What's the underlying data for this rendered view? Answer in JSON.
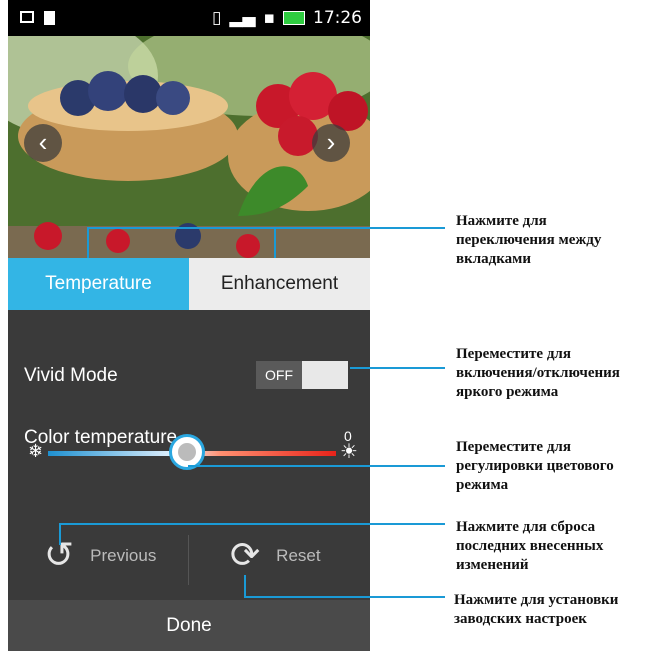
{
  "status_bar": {
    "time": "17:26",
    "icons": [
      "screen-icon",
      "file-icon",
      "vibrate-icon",
      "signal-icon",
      "sd-card-icon",
      "battery-icon"
    ]
  },
  "photo": {
    "prev_glyph": "‹",
    "next_glyph": "›"
  },
  "tabs": [
    {
      "label": "Temperature",
      "active": true
    },
    {
      "label": "Enhancement",
      "active": false
    }
  ],
  "vivid_mode": {
    "label": "Vivid Mode",
    "toggle_state": "OFF"
  },
  "color_temperature": {
    "label": "Color temperature",
    "value": "0",
    "slider_level": 0.5
  },
  "controls": {
    "previous_label": "Previous",
    "reset_label": "Reset"
  },
  "done_label": "Done",
  "callouts": {
    "tabs": "Нажмите для\nпереключения между\nвкладками",
    "vivid": "Переместите для\nвключения/отключения\nяркого режима",
    "slider": "Переместите для\nрегулировки цветового\nрежима",
    "previous": "Нажмите для сброса\nпоследних внесенных\nизменений",
    "reset": "Нажмите для установки\nзаводских настроек"
  },
  "colors": {
    "accent": "#33b5e5",
    "callout_line": "#1a9ad6"
  }
}
